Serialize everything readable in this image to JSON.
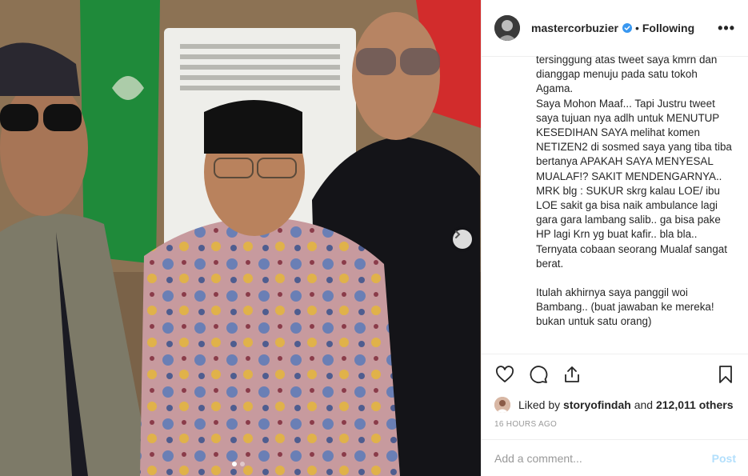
{
  "post": {
    "username": "mastercorbuzier",
    "verified_icon": "verified-badge-icon",
    "separator": "•",
    "follow_status": "Following",
    "more_icon": "more-options-icon",
    "more_label": "•••",
    "caption_lines": [
      "tersinggung atas tweet saya kmrn dan dianggap menuju pada satu tokoh Agama.",
      "Saya Mohon Maaf... Tapi Justru tweet saya tujuan nya adlh untuk MENUTUP KESEDIHAN SAYA melihat komen NETIZEN2 di sosmed saya yang tiba tiba bertanya APAKAH SAYA MENYESAL MUALAF!? SAKIT MENDENGARNYA.. MRK blg : SUKUR skrg kalau LOE/ ibu LOE sakit ga bisa naik ambulance lagi gara gara lambang salib.. ga bisa pake HP lagi Krn yg buat kafir.. bla bla..",
      "Ternyata cobaan seorang Mualaf sangat berat.",
      "",
      "Itulah akhirnya saya panggil woi Bambang.. (buat jawaban ke mereka! bukan untuk satu orang)"
    ],
    "liked_by_prefix": "Liked by ",
    "liked_by_user": "storyofindah",
    "liked_by_and": " and ",
    "liked_by_count": "212,011 others",
    "timestamp": "16 HOURS AGO",
    "comment_placeholder": "Add a comment...",
    "post_button": "Post",
    "carousel": {
      "slide_count": 2,
      "active_index": 0
    },
    "colors": {
      "verified_blue": "#3897f0",
      "post_disabled": "#b2dffc",
      "muted": "#999999"
    }
  }
}
